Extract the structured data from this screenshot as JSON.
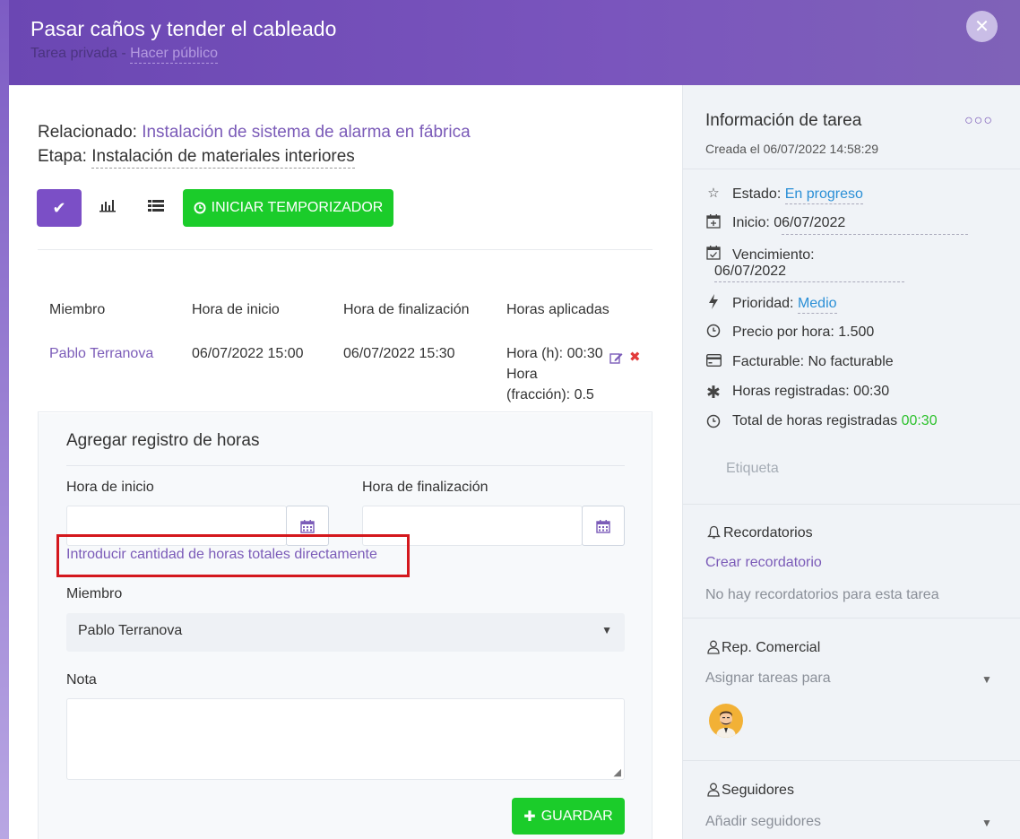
{
  "header": {
    "title": "Pasar caños y tender el cableado",
    "subtitle": "Tarea privada",
    "subtitle_sep": " - ",
    "subtitle_link": "Hacer público"
  },
  "related": {
    "label": "Relacionado:",
    "value": "Instalación de sistema de alarma en fábrica",
    "stage_label": "Etapa:",
    "stage_value": "Instalación de materiales interiores"
  },
  "toolbar": {
    "timer_label": "INICIAR TEMPORIZADOR"
  },
  "table": {
    "columns": [
      "Miembro",
      "Hora de inicio",
      "Hora de finalización",
      "Horas aplicadas"
    ],
    "rows": [
      {
        "member": "Pablo Terranova",
        "start": "06/07/2022 15:00",
        "end": "06/07/2022 15:30",
        "hours_line1": "Hora (h): 00:30",
        "hours_line2": "Hora",
        "hours_line3": "(fracción): 0.5"
      }
    ]
  },
  "form": {
    "title": "Agregar registro de horas",
    "start_label": "Hora de inicio",
    "end_label": "Hora de finalización",
    "direct_link": "Introducir cantidad de horas totales directamente",
    "member_label": "Miembro",
    "member_value": "Pablo Terranova",
    "note_label": "Nota",
    "save_label": "GUARDAR"
  },
  "sidebar": {
    "title": "Información de tarea",
    "created": "Creada el 06/07/2022 14:58:29",
    "status_label": "Estado:",
    "status_value": "En progreso",
    "start_label": "Inicio:",
    "start_value": "06/07/2022",
    "due_label": "Vencimiento:",
    "due_value": "06/07/2022",
    "priority_label": "Prioridad:",
    "priority_value": "Medio",
    "price": "Precio por hora: 1.500",
    "billable": "Facturable: No facturable",
    "logged": "Horas registradas: 00:30",
    "total_label": "Total de horas registradas",
    "total_value": "00:30",
    "tag_placeholder": "Etiqueta",
    "reminders_title": "Recordatorios",
    "create_reminder": "Crear recordatorio",
    "no_reminders": "No hay recordatorios para esta tarea",
    "sales_title": "Rep. Comercial",
    "assign_placeholder": "Asignar tareas para",
    "followers_title": "Seguidores",
    "add_followers": "Añadir seguidores"
  },
  "colors": {
    "accent": "#7b5bb8",
    "green": "#1bcc2a",
    "highlight": "#d4181d",
    "link_blue": "#2a8fd6"
  }
}
